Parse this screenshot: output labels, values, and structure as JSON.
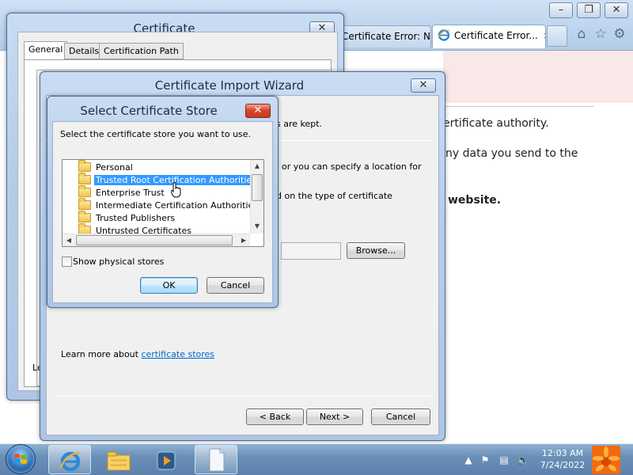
{
  "browser": {
    "tabs": [
      {
        "label": "Certificate Error: N..."
      },
      {
        "label": "Certificate Error...",
        "close": "×"
      }
    ],
    "toolbar_icons": [
      "home-icon",
      "favorites-star-icon",
      "tools-gear-icon"
    ],
    "window_controls": [
      "minimize",
      "restore",
      "close"
    ],
    "body_text": {
      "line1": "ertificate authority.",
      "line2": "ny data you send to the",
      "line3": "website."
    }
  },
  "certificate_dialog": {
    "title": "Certificate",
    "tabs": [
      "General",
      "Details",
      "Certification Path"
    ],
    "footer_fragment": "Le"
  },
  "import_wizard": {
    "title": "Certificate Import Wizard",
    "text_kept": "s are kept.",
    "text_specify": "or you can specify a location for",
    "text_based": "d on the type of certificate",
    "browse_label": "Browse...",
    "learn_more_prefix": "Learn more about ",
    "learn_more_link": "certificate stores",
    "back_label": "< Back",
    "next_label": "Next >",
    "cancel_label": "Cancel"
  },
  "select_store_dialog": {
    "title": "Select Certificate Store",
    "instruction": "Select the certificate store you want to use.",
    "stores": [
      {
        "label": "Personal",
        "selected": false
      },
      {
        "label": "Trusted Root Certification Authorities",
        "selected": true
      },
      {
        "label": "Enterprise Trust",
        "selected": false
      },
      {
        "label": "Intermediate Certification Authorities",
        "selected": false
      },
      {
        "label": "Trusted Publishers",
        "selected": false
      },
      {
        "label": "Untrusted Certificates",
        "selected": false
      }
    ],
    "show_physical_label": "Show physical stores",
    "show_physical_checked": false,
    "ok_label": "OK",
    "cancel_label": "Cancel"
  },
  "taskbar": {
    "pinned": [
      "internet-explorer",
      "windows-explorer",
      "media-player",
      "blank-document"
    ],
    "clock_time": "12:03 AM",
    "clock_date": "7/24/2022"
  },
  "colors": {
    "selection": "#3399ff",
    "link": "#0066cc",
    "close_red": "#d9472b"
  }
}
